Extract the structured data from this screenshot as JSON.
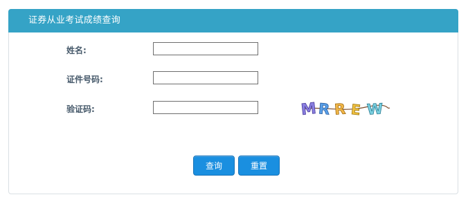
{
  "panel": {
    "title": "证券从业考试成绩查询"
  },
  "form": {
    "name_label": "姓名:",
    "name_value": "",
    "id_label": "证件号码:",
    "id_value": "",
    "captcha_label": "验证码:",
    "captcha_value": "",
    "captcha_text": "MRREW"
  },
  "buttons": {
    "query_label": "查询",
    "reset_label": "重置"
  },
  "colors": {
    "header": "#35a3c6",
    "button": "#1a8fe0",
    "label": "#475a6b"
  }
}
